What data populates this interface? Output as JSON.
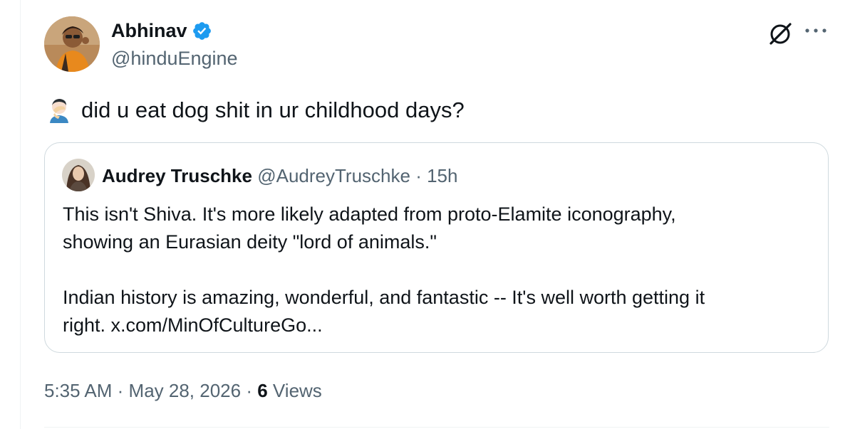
{
  "author": {
    "name": "Abhinav",
    "handle": "@hinduEngine",
    "avatar_icon": "person-avatar",
    "verified_icon": "verified-badge-icon"
  },
  "tweet": {
    "emoji_icon": "facepalm-emoji",
    "text": "did u eat dog shit in ur childhood days?"
  },
  "quote": {
    "name": "Audrey Truschke",
    "handle": "@AudreyTruschke",
    "separator": "·",
    "time": "15h",
    "paragraph1_line1": "This isn't Shiva. It's more likely adapted from proto-Elamite iconography,",
    "paragraph1_line2": "showing an Eurasian deity \"lord of animals.\"",
    "paragraph2_line1": "Indian history is amazing, wonderful, and fantastic -- It's well worth getting it",
    "paragraph2_line2": "right. x.com/MinOfCultureGo..."
  },
  "meta": {
    "time": "5:35 AM",
    "date": "May 28, 2026",
    "views_count": "6",
    "views_label": "Views"
  },
  "colors": {
    "verified_blue": "#1d9bf0",
    "secondary_text": "#536471",
    "primary_text": "#0f1419",
    "border": "#cfd9de"
  }
}
